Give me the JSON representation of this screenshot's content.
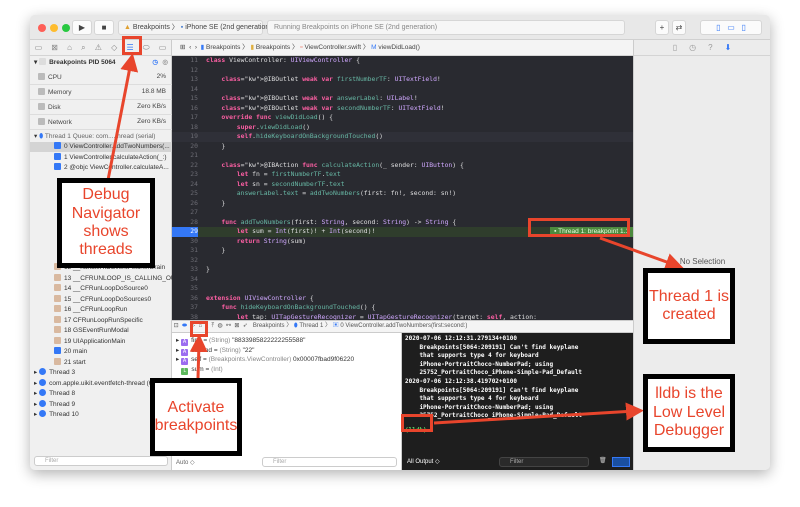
{
  "toolbar": {
    "scheme": "Breakpoints",
    "device": "iPhone SE (2nd generation)",
    "status": "Running Breakpoints on iPhone SE (2nd generation)",
    "run_icon": "play-icon",
    "stop_icon": "stop-icon",
    "add": "+",
    "swap": "⇄"
  },
  "navigator": {
    "process": "Breakpoints PID 5064",
    "gauges": [
      {
        "label": "CPU",
        "value": "2%"
      },
      {
        "label": "Memory",
        "value": "18.8 MB"
      },
      {
        "label": "Disk",
        "value": "Zero KB/s"
      },
      {
        "label": "Network",
        "value": "Zero KB/s"
      }
    ],
    "thread1": "Thread 1 Queue: com....thread (serial)",
    "frames": [
      "0 ViewController.addTwoNumbers(...",
      "1 ViewController.calculateAction(_:)",
      "2 @objc ViewController.calculateA..."
    ],
    "frames_lower": [
      "12 __handleHIDEventFetcherDrain",
      "13 __CFRUNLOOP_IS_CALLING_OU...",
      "14 __CFRunLoopDoSource0",
      "15 __CFRunLoopDoSources0",
      "16 __CFRunLoopRun",
      "17 CFRunLoopRunSpecific",
      "18 GSEventRunModal",
      "19 UIApplicationMain",
      "20 main",
      "21 start"
    ],
    "threads": [
      "Thread 3",
      "com.apple.uikit.eventfetch-thread (6)",
      "Thread 8",
      "Thread 9",
      "Thread 10"
    ],
    "filter_placeholder": "Filter"
  },
  "editor": {
    "breadcrumb": [
      "Breakpoints",
      "Breakpoints",
      "ViewController.swift",
      "viewDidLoad()"
    ],
    "current_line": 29,
    "breakpoint_label": "Thread 1: breakpoint 1.1",
    "lines": [
      {
        "n": 11,
        "t": "class ViewController: UIViewController {"
      },
      {
        "n": 12,
        "t": ""
      },
      {
        "n": 13,
        "t": "    @IBOutlet weak var firstNumberTF: UITextField!"
      },
      {
        "n": 14,
        "t": ""
      },
      {
        "n": 15,
        "t": "    @IBOutlet weak var answerLabel: UILabel!"
      },
      {
        "n": 16,
        "t": "    @IBOutlet weak var secondNumberTF: UITextField!"
      },
      {
        "n": 17,
        "t": "    override func viewDidLoad() {"
      },
      {
        "n": 18,
        "t": "        super.viewDidLoad()"
      },
      {
        "n": 19,
        "t": "        self.hideKeyboardOnBackgroundTouched()"
      },
      {
        "n": 20,
        "t": "    }"
      },
      {
        "n": 21,
        "t": ""
      },
      {
        "n": 22,
        "t": "    @IBAction func calculateAction(_ sender: UIButton) {"
      },
      {
        "n": 23,
        "t": "        let fn = firstNumberTF.text"
      },
      {
        "n": 24,
        "t": "        let sn = secondNumberTF.text"
      },
      {
        "n": 25,
        "t": "        answerLabel.text = addTwoNumbers(first: fn!, second: sn!)"
      },
      {
        "n": 26,
        "t": "    }"
      },
      {
        "n": 27,
        "t": ""
      },
      {
        "n": 28,
        "t": "    func addTwoNumbers(first: String, second: String) -> String {"
      },
      {
        "n": 29,
        "t": "        let sum = Int(first)! + Int(second)!"
      },
      {
        "n": 30,
        "t": "        return String(sum)"
      },
      {
        "n": 31,
        "t": "    }"
      },
      {
        "n": 32,
        "t": ""
      },
      {
        "n": 33,
        "t": "}"
      },
      {
        "n": 34,
        "t": ""
      },
      {
        "n": 35,
        "t": ""
      },
      {
        "n": 36,
        "t": "extension UIViewController {"
      },
      {
        "n": 37,
        "t": "    func hideKeyboardOnBackgroundTouched() {"
      },
      {
        "n": 38,
        "t": "        let tap: UITapGestureRecognizer = UITapGestureRecognizer(target: self, action:"
      }
    ]
  },
  "debug": {
    "breadcrumb": [
      "Breakpoints",
      "Thread 1",
      "0 ViewController.addTwoNumbers(first:second:)"
    ],
    "variables": [
      {
        "badge": "A",
        "name": "first",
        "type": "(String)",
        "value": "\"8833985822222255588\""
      },
      {
        "badge": "A",
        "name": "second",
        "type": "(String)",
        "value": "\"22\""
      },
      {
        "badge": "A",
        "name": "self",
        "type": "(Breakpoints.ViewController)",
        "value": "0x00007fbad9f06220"
      },
      {
        "badge": "L",
        "name": "sum",
        "type": "(Int)",
        "value": ""
      }
    ],
    "auto": "Auto ◇",
    "filter_placeholder": "Filter",
    "console": [
      "2020-07-06 12:12:31.279134+0100",
      "    Breakpoints[5064:209191] Can't find keyplane",
      "    that supports type 4 for keyboard",
      "    iPhone-PortraitChoco-NumberPad; using",
      "    25752_PortraitChoco_iPhone-Simple-Pad_Default",
      "2020-07-06 12:12:38.419702+0100",
      "    Breakpoints[5064:209191] Can't find keyplane",
      "    that supports type 4 for keyboard",
      "    iPhone-PortraitChoco-NumberPad; using",
      "    25752_PortraitChoco_iPhone-Simple-Pad_Default"
    ],
    "prompt": "(lldb)",
    "output_select": "All Output ◇"
  },
  "inspector": {
    "empty": "No Selection"
  },
  "annotations": {
    "debug_navigator": "Debug Navigator shows threads",
    "activate": "Activate breakpoints",
    "thread_created": "Thread 1 is created",
    "lldb": "lldb is the Low Level Debugger"
  },
  "colors": {
    "accent": "#3478f6",
    "annotation_red": "#e8452c",
    "editor_bg": "#292a30",
    "console_bg": "#1e1e1e",
    "breakpoint_green": "#4c8a3e"
  }
}
